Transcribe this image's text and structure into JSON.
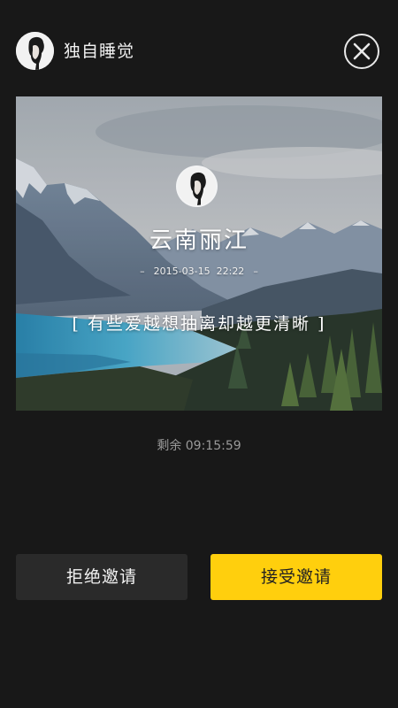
{
  "header": {
    "username": "独自睡觉",
    "avatar_icon": "portrait-avatar",
    "close_icon": "close-circle-icon"
  },
  "card": {
    "background": "mountain-lake-photo",
    "location": "云南丽江",
    "date": "2015-03-15",
    "time": "22:22",
    "dash": "–",
    "quote": "[ 有些爱越想抽离却越更清晰 ]"
  },
  "countdown": {
    "text": "剩余 09:15:59"
  },
  "actions": {
    "reject_label": "拒绝邀请",
    "accept_label": "接受邀请"
  },
  "colors": {
    "background": "#181818",
    "accent": "#ffcf0d",
    "reject_button": "#2a2a2a"
  }
}
